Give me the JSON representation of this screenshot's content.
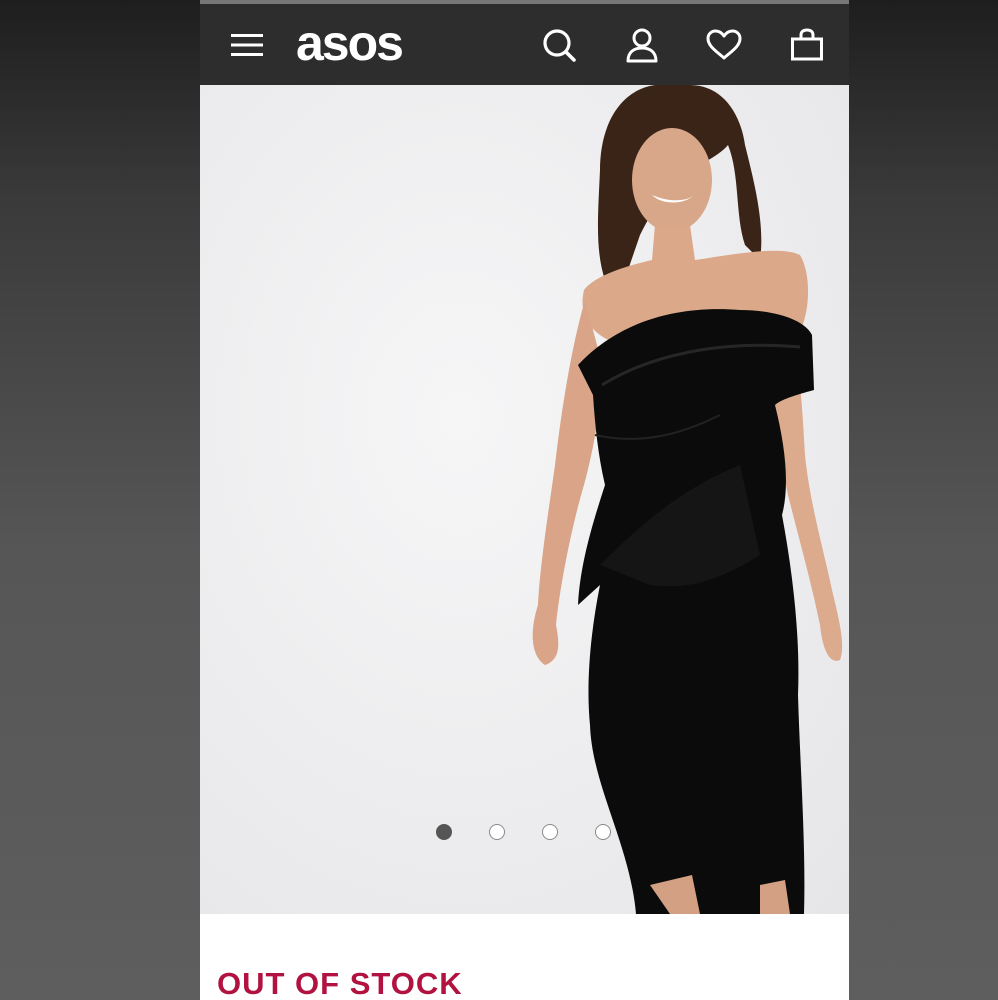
{
  "header": {
    "logo_text": "asos",
    "icons": [
      "menu-icon",
      "search-icon",
      "account-icon",
      "heart-icon",
      "bag-icon"
    ],
    "background": "#2d2d2d"
  },
  "gallery": {
    "image_count": 4,
    "active_index": 0,
    "image_description_icon": "product-photo"
  },
  "product": {
    "status_text": "OUT OF STOCK",
    "status_color": "#b1123f"
  }
}
